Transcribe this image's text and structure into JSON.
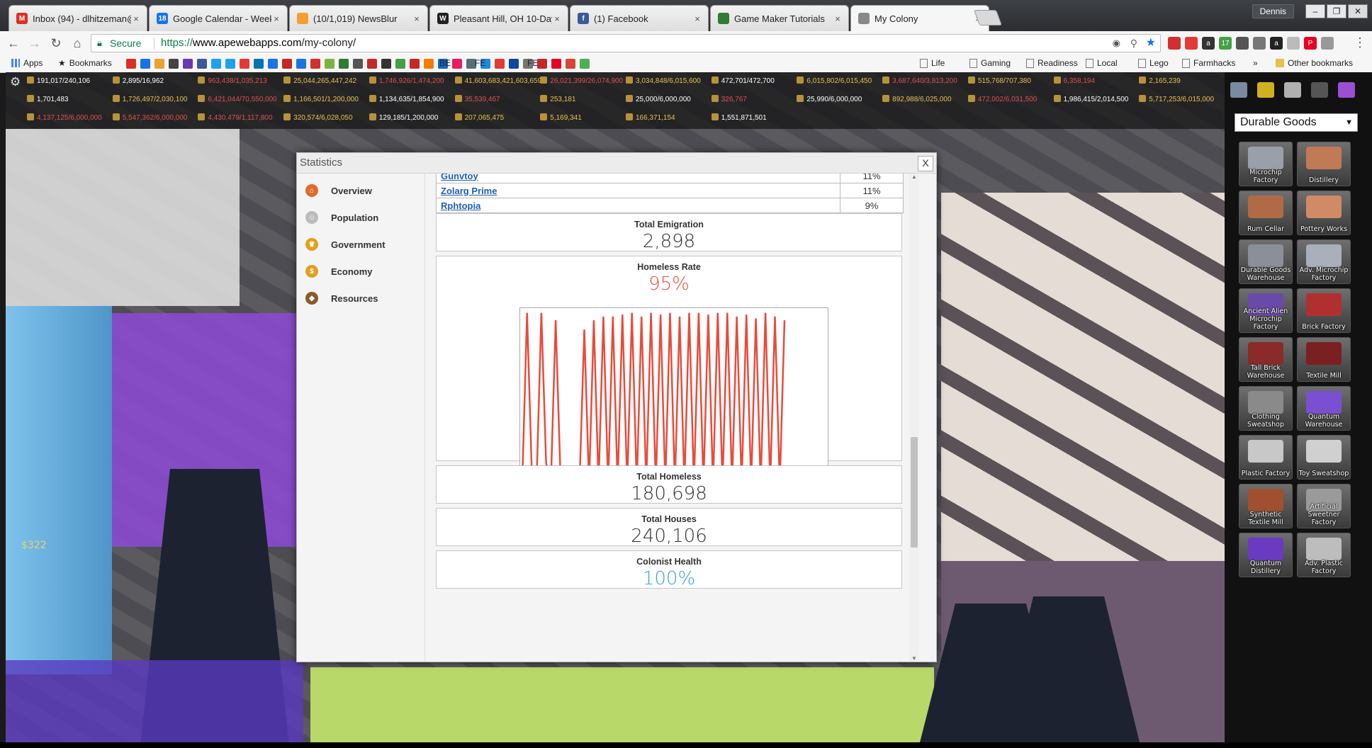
{
  "browser": {
    "tabs": [
      {
        "title": "Inbox (94) - dlhitzeman@",
        "fav": "M",
        "color": "#d93025",
        "left": 0
      },
      {
        "title": "Google Calendar - Week",
        "fav": "18",
        "color": "#1a73e8",
        "left": 0
      },
      {
        "title": "(10/1,019) NewsBlur",
        "fav": "",
        "color": "#f0a030",
        "left": 0
      },
      {
        "title": "Pleasant Hill, OH 10-Day",
        "fav": "W",
        "color": "#222222",
        "left": 0
      },
      {
        "title": "(1) Facebook",
        "fav": "f",
        "color": "#3b5998",
        "left": 0
      },
      {
        "title": "Game Maker Tutorials",
        "fav": "",
        "color": "#2e7d32",
        "left": 0
      },
      {
        "title": "My Colony",
        "fav": "",
        "color": "#888888",
        "left": 0
      }
    ],
    "user": "Dennis",
    "secure_label": "Secure",
    "url_scheme": "https://",
    "url_host": "www.apewebapps.com",
    "url_path": "/my-colony/",
    "bookmarks": {
      "apps": "Apps",
      "bookmarks": "Bookmarks",
      "icon_labels": [
        "BE",
        "FE",
        "FE"
      ],
      "folders": [
        "Life",
        "Gaming",
        "Readiness",
        "Local",
        "Lego",
        "Farmhacks"
      ],
      "more": "»",
      "other": "Other bookmarks"
    }
  },
  "hud": {
    "row1": [
      "191,017/240,106",
      "2,895/16,962",
      "963,438/1,035,213",
      "25,044,265,447,242",
      "1,746,926/1,474,200",
      "41,603,683,421,603,659",
      "26,021,399/26,074,900",
      "3,034,848/6,015,600",
      "472,701/472,700",
      "6,015,802/6,015,450",
      "3,687,640/3,813,200",
      "515,768/707,380",
      "6,358,194",
      "2,165,239"
    ],
    "row2": [
      "1,701,483",
      "1,726,497/2,030,100",
      "6,421,044/70,550,000",
      "1,166,501/1,200,000",
      "1,134,635/1,854,900",
      "35,539,467",
      "253,181",
      "25,000/6,000,000",
      "326,767",
      "25,990/6,000,000",
      "892,988/6,025,000",
      "472,002/6,031,500",
      "1,986,415/2,014,500",
      "5,717,253/6,015,000"
    ],
    "row3": [
      "4,137,125/6,000,000",
      "5,547,362/6,000,000",
      "4,430,479/1,117,800",
      "320,574/6,028,050",
      "129,185/1,200,000",
      "207,065,475",
      "5,169,341",
      "166,371,154",
      "1,551,871,501"
    ],
    "money": "$322"
  },
  "panel": {
    "dropdown": "Durable Goods",
    "buildings": [
      {
        "label": "Microchip Factory",
        "color": "#9aa0aa"
      },
      {
        "label": "Distillery",
        "color": "#c07a55"
      },
      {
        "label": "Rum Cellar",
        "color": "#b06a45"
      },
      {
        "label": "Pottery Works",
        "color": "#d08a65"
      },
      {
        "label": "Durable Goods Warehouse",
        "color": "#8a8f99"
      },
      {
        "label": "Adv. Microchip Factory",
        "color": "#a9b0bb"
      },
      {
        "label": "Ancient Alien Microchip Factory",
        "color": "#6a4aa8"
      },
      {
        "label": "Brick Factory",
        "color": "#b03030"
      },
      {
        "label": "Tall Brick Warehouse",
        "color": "#8a2a2a"
      },
      {
        "label": "Textile Mill",
        "color": "#7a2020"
      },
      {
        "label": "Clothing Sweatshop",
        "color": "#8a8a8a"
      },
      {
        "label": "Quantum Warehouse",
        "color": "#7a50d0"
      },
      {
        "label": "Plastic Factory",
        "color": "#c8c8c8"
      },
      {
        "label": "Toy Sweatshop",
        "color": "#d0d0d0"
      },
      {
        "label": "Synthetic Textile Mill",
        "color": "#a05030"
      },
      {
        "label": "Artificial Sweetner Factory",
        "color": "#9a9a9a"
      },
      {
        "label": "Quantum Distillery",
        "color": "#6a3ac0"
      },
      {
        "label": "Adv. Plastic Factory",
        "color": "#bdbdbd"
      }
    ]
  },
  "dialog": {
    "title": "Statistics",
    "close": "X",
    "nav": [
      {
        "label": "Overview",
        "color": "#e06a2a",
        "glyph": "⌂"
      },
      {
        "label": "Population",
        "color": "#bbbbbb",
        "glyph": "☺"
      },
      {
        "label": "Government",
        "color": "#e0a020",
        "glyph": "♛"
      },
      {
        "label": "Economy",
        "color": "#e0a020",
        "glyph": "$"
      },
      {
        "label": "Resources",
        "color": "#8a5a2a",
        "glyph": "◆"
      }
    ],
    "table": [
      {
        "name": "Gunvtoy",
        "pct": "11%"
      },
      {
        "name": "Zolarg Prime",
        "pct": "11%"
      },
      {
        "name": "Rphtopia",
        "pct": "9%"
      }
    ],
    "total_emigration": {
      "label": "Total Emigration",
      "value": "2,898"
    },
    "homeless_rate": {
      "label": "Homeless Rate",
      "value": "95%"
    },
    "total_homeless": {
      "label": "Total Homeless",
      "value": "180,698"
    },
    "total_houses": {
      "label": "Total Houses",
      "value": "240,106"
    },
    "colonist_health": {
      "label": "Colonist Health",
      "value": "100%"
    }
  },
  "chart_data": {
    "type": "line",
    "title": "",
    "xlabel": "",
    "ylabel": "",
    "ylim": [
      0,
      100
    ],
    "series": [
      {
        "color": "#e74c3c",
        "values": [
          8,
          99,
          12,
          8,
          99,
          18,
          8,
          95,
          12,
          6,
          6,
          6,
          6,
          90,
          6,
          95,
          6,
          97,
          6,
          97,
          6,
          98,
          6,
          99,
          6,
          97,
          6,
          99,
          6,
          98,
          6,
          99,
          6,
          97,
          6,
          99,
          6,
          99,
          6,
          98,
          6,
          99,
          6,
          99,
          6,
          97,
          6,
          98,
          6,
          96,
          6,
          99,
          6,
          97,
          6,
          95
        ]
      }
    ]
  }
}
